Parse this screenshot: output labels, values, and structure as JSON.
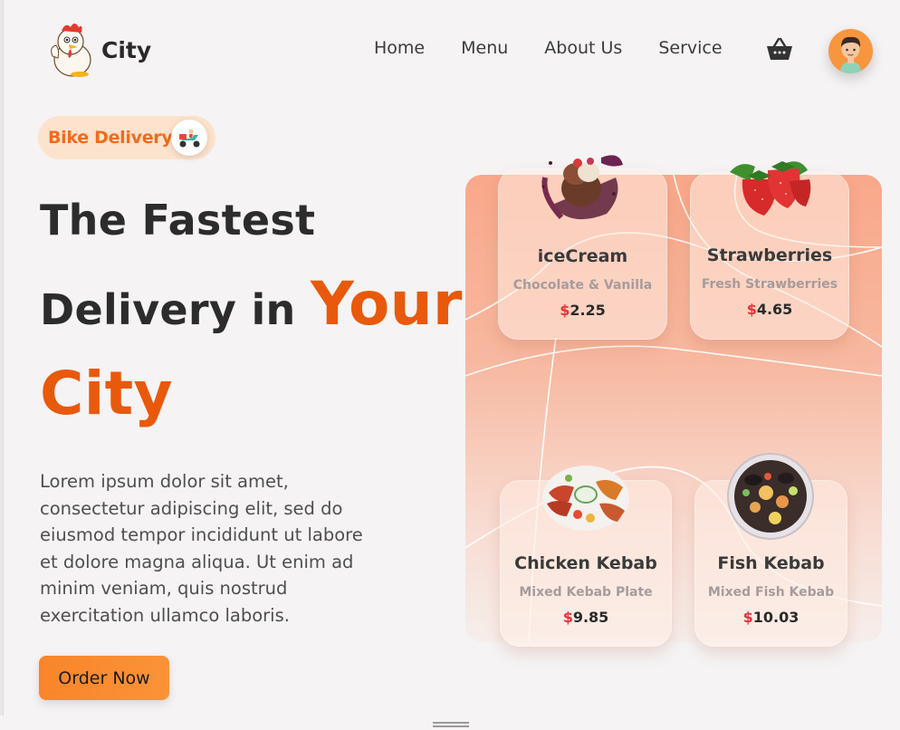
{
  "brand": {
    "name": "City"
  },
  "nav": {
    "items": [
      "Home",
      "Menu",
      "About Us",
      "Service"
    ]
  },
  "icons": {
    "cart": "shopping-basket-icon",
    "avatar": "user-avatar",
    "badge": "delivery-scooter-icon"
  },
  "hero": {
    "badge": "Bike Delivery",
    "line1": "The Fastest",
    "line2_prefix": "Delivery in",
    "line2_accent": "Your",
    "line3": "City",
    "description": "Lorem ipsum dolor sit amet, consectetur adipiscing elit, sed do eiusmod tempor incididunt ut labore et dolore magna aliqua. Ut enim ad minim veniam, quis nostrud exercitation ullamco laboris.",
    "cta": "Order Now"
  },
  "menu_cards": [
    {
      "name": "iceCream",
      "subtitle": "Chocolate & Vanilla",
      "currency": "$",
      "price": "2.25"
    },
    {
      "name": "Strawberries",
      "subtitle": "Fresh Strawberries",
      "currency": "$",
      "price": "4.65"
    },
    {
      "name": "Chicken Kebab",
      "subtitle": "Mixed Kebab Plate",
      "currency": "$",
      "price": "9.85"
    },
    {
      "name": "Fish Kebab",
      "subtitle": "Mixed Fish Kebab",
      "currency": "$",
      "price": "10.03"
    }
  ],
  "colors": {
    "accent": "#e8590c",
    "button": "#f9852a",
    "badge_bg": "#fde3cd",
    "price_currency": "#e8323a",
    "panel_top": "#f9a88a"
  }
}
